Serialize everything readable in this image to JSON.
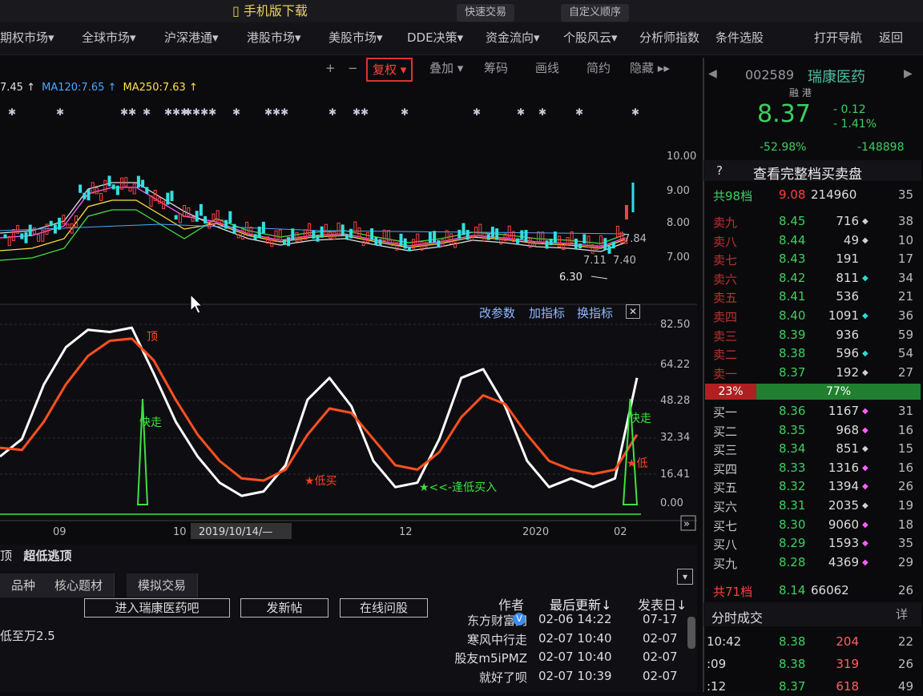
{
  "top": {
    "mobile_download": "手机版下载",
    "buttons": [
      "快速交易",
      "自定义顺序"
    ]
  },
  "nav": [
    "期权市场",
    "全球市场",
    "沪深港通",
    "港股市场",
    "美股市场",
    "DDE决策",
    "资金流向",
    "个股风云",
    "分析师指数",
    "条件选股",
    "打开导航",
    "返回"
  ],
  "toolbar": [
    "+",
    "−",
    "复权",
    "叠加",
    "筹码",
    "画线",
    "简约",
    "隐藏"
  ],
  "ma_line": [
    {
      "text": "7.45 ↑",
      "color": "#e0e0e0"
    },
    {
      "text": "MA120:7.65 ↑",
      "color": "#4aa8ff"
    },
    {
      "text": "MA250:7.63 ↑",
      "color": "#ffe040"
    }
  ],
  "stock": {
    "code": "002589",
    "name": "瑞康医药",
    "tags": "融 港",
    "price": "8.37",
    "change": "0.12",
    "change_pct": "1.41%",
    "stat1": "-52.98%",
    "stat2": "-148898",
    "help": "?",
    "view_full": "查看完整档买卖盘"
  },
  "chart_data": [
    {
      "type": "line",
      "title": "K-line",
      "y_ticks": [
        "10.00",
        "9.00",
        "8.00",
        "7.00"
      ],
      "annotations": [
        "6.30",
        "7.11",
        "7.40",
        "7.84"
      ]
    },
    {
      "type": "line",
      "title": "超低逃顶",
      "y_ticks": [
        "82.50",
        "64.22",
        "48.28",
        "32.34",
        "16.41",
        "0.00"
      ],
      "x_ticks": [
        "09",
        "10",
        "12",
        "2020",
        "02"
      ],
      "date_label": "2019/10/14/—",
      "labels": [
        "顶",
        "快走",
        "★低买",
        "★<<-逢低买入",
        "快走",
        "★低"
      ],
      "series": [
        {
          "values": [
            22,
            30,
            55,
            72,
            80,
            79,
            81,
            60,
            38,
            22,
            10,
            4,
            6,
            18,
            48,
            58,
            45,
            20,
            8,
            10,
            30,
            58,
            62,
            45,
            20,
            8,
            12,
            8,
            12,
            58
          ]
        },
        {
          "values": [
            26,
            25,
            38,
            55,
            68,
            75,
            76,
            66,
            48,
            32,
            20,
            12,
            11,
            16,
            32,
            44,
            42,
            30,
            18,
            16,
            24,
            40,
            50,
            46,
            32,
            20,
            16,
            14,
            16,
            32
          ]
        }
      ]
    }
  ],
  "indicator_links": [
    "改参数",
    "加指标",
    "换指标",
    "✕"
  ],
  "indicator_name": "超低逃顶",
  "indicator_prefix": "顶",
  "orderbook": {
    "total_ask_label": "共98档",
    "total_ask_price": "9.08",
    "total_ask_vol": "214960",
    "total_ask_cnt": "35",
    "asks": [
      {
        "label": "卖九",
        "price": "8.45",
        "vol": "716",
        "cnt": "38",
        "dot": "#d0d0d0"
      },
      {
        "label": "卖八",
        "price": "8.44",
        "vol": "49",
        "cnt": "10",
        "dot": "#d0d0d0"
      },
      {
        "label": "卖七",
        "price": "8.43",
        "vol": "191",
        "cnt": "17",
        "dot": ""
      },
      {
        "label": "卖六",
        "price": "8.42",
        "vol": "811",
        "cnt": "34",
        "dot": "#30d8d0"
      },
      {
        "label": "卖五",
        "price": "8.41",
        "vol": "536",
        "cnt": "21",
        "dot": ""
      },
      {
        "label": "卖四",
        "price": "8.40",
        "vol": "1091",
        "cnt": "36",
        "dot": "#30d8d0"
      },
      {
        "label": "卖三",
        "price": "8.39",
        "vol": "936",
        "cnt": "59",
        "dot": ""
      },
      {
        "label": "卖二",
        "price": "8.38",
        "vol": "596",
        "cnt": "54",
        "dot": "#30d8d0"
      },
      {
        "label": "卖一",
        "price": "8.37",
        "vol": "192",
        "cnt": "27",
        "dot": "#d0d0d0"
      }
    ],
    "ratio_left": "23%",
    "ratio_right": "77%",
    "bids": [
      {
        "label": "买一",
        "price": "8.36",
        "vol": "1167",
        "cnt": "31",
        "dot": "#ff60ff"
      },
      {
        "label": "买二",
        "price": "8.35",
        "vol": "968",
        "cnt": "16",
        "dot": "#ff60ff"
      },
      {
        "label": "买三",
        "price": "8.34",
        "vol": "851",
        "cnt": "15",
        "dot": "#d0d0d0"
      },
      {
        "label": "买四",
        "price": "8.33",
        "vol": "1316",
        "cnt": "16",
        "dot": "#ff60ff"
      },
      {
        "label": "买五",
        "price": "8.32",
        "vol": "1394",
        "cnt": "26",
        "dot": "#ff60ff"
      },
      {
        "label": "买六",
        "price": "8.31",
        "vol": "2035",
        "cnt": "19",
        "dot": "#d0d0d0"
      },
      {
        "label": "买七",
        "price": "8.30",
        "vol": "9060",
        "cnt": "18",
        "dot": "#ff60ff"
      },
      {
        "label": "买八",
        "price": "8.29",
        "vol": "1593",
        "cnt": "35",
        "dot": "#ff60ff"
      },
      {
        "label": "买九",
        "price": "8.28",
        "vol": "4369",
        "cnt": "29",
        "dot": "#ff60ff"
      }
    ],
    "total_bid_label": "共71档",
    "total_bid_price": "8.14",
    "total_bid_vol": "66062",
    "total_bid_cnt": "26"
  },
  "ticks": {
    "title": "分时成交",
    "more": "详",
    "rows": [
      {
        "time": "10:42",
        "price": "8.38",
        "vol": "204",
        "cnt": "22"
      },
      {
        "time": ":09",
        "price": "8.38",
        "vol": "319",
        "cnt": "26"
      },
      {
        "time": ":12",
        "price": "8.37",
        "vol": "618",
        "cnt": "49"
      }
    ]
  },
  "bottom": {
    "tabs": [
      "品种",
      "核心题材",
      "模拟交易"
    ],
    "buttons": [
      "进入瑞康医药吧",
      "发新帖",
      "在线问股"
    ],
    "headers": [
      "作者",
      "最后更新↓",
      "发表日↓"
    ],
    "first_line": "低至万2.5",
    "posts": [
      {
        "author": "东方财富网",
        "updated": "02-06 14:22",
        "posted": "07-17"
      },
      {
        "author": "寒风中行走",
        "updated": "02-07 10:40",
        "posted": "02-07"
      },
      {
        "author": "股友m5iPMZ",
        "updated": "02-07 10:40",
        "posted": "02-07"
      },
      {
        "author": "就好了呗",
        "updated": "02-07 10:39",
        "posted": "02-07"
      }
    ]
  }
}
